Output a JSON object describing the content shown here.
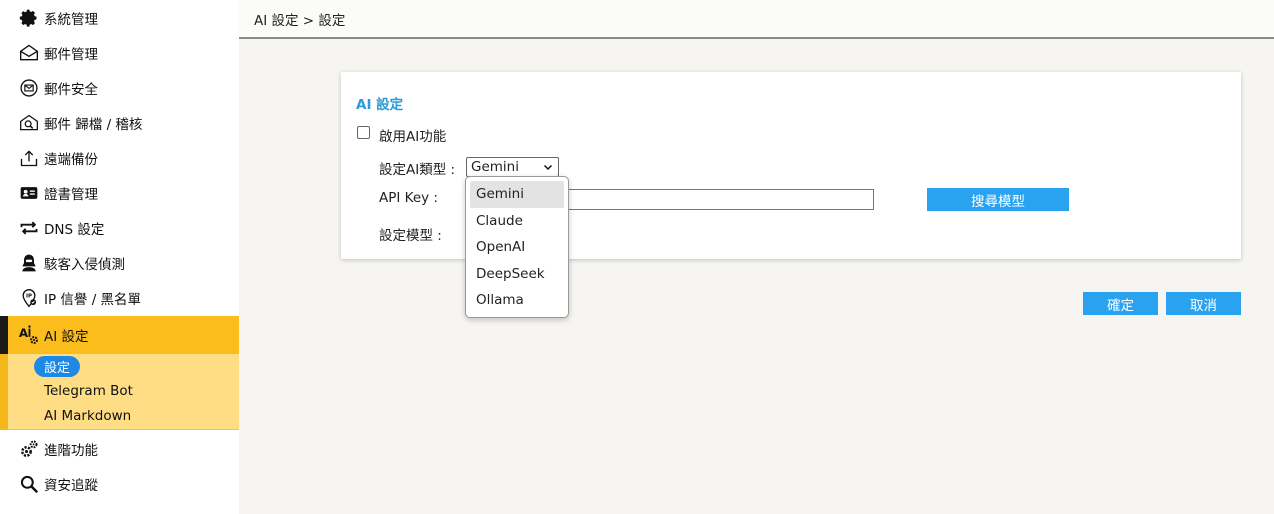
{
  "breadcrumb": "AI 設定 > 設定",
  "sidebar": {
    "items": [
      {
        "label": "系統管理",
        "icon": "gear-icon"
      },
      {
        "label": "郵件管理",
        "icon": "envelope-icon"
      },
      {
        "label": "郵件安全",
        "icon": "mail-shield-icon"
      },
      {
        "label": "郵件 歸檔 / 稽核",
        "icon": "mail-search-icon"
      },
      {
        "label": "遠端備份",
        "icon": "upload-icon"
      },
      {
        "label": "證書管理",
        "icon": "id-card-icon"
      },
      {
        "label": "DNS 設定",
        "icon": "swap-arrows-icon"
      },
      {
        "label": "駭客入侵偵測",
        "icon": "hacker-icon"
      },
      {
        "label": "IP 信譽 / 黑名單",
        "icon": "ip-pin-icon"
      }
    ],
    "active": {
      "label": "AI 設定",
      "icon": "ai-gear-icon",
      "subitems": [
        "設定",
        "Telegram Bot",
        "AI Markdown"
      ]
    },
    "bottom_items": [
      {
        "label": "進階功能",
        "icon": "gears-icon"
      },
      {
        "label": "資安追蹤",
        "icon": "magnifier-icon"
      }
    ]
  },
  "card": {
    "title": "AI 設定",
    "enable_label": "啟用AI功能",
    "type_label": "設定AI類型 :",
    "type_value": "Gemini",
    "apikey_label": "API Key :",
    "apikey_value": "",
    "model_label": "設定模型 :",
    "search_button": "搜尋模型"
  },
  "dropdown": {
    "options": [
      "Gemini",
      "Claude",
      "OpenAI",
      "DeepSeek",
      "Ollama"
    ],
    "selected": "Gemini"
  },
  "actions": {
    "ok": "確定",
    "cancel": "取消"
  },
  "colors": {
    "accent_blue": "#29a3f0",
    "active_nav": "#fbbd1c",
    "active_sub_bg": "#ffdd85",
    "title_blue": "#2c9ad6"
  }
}
